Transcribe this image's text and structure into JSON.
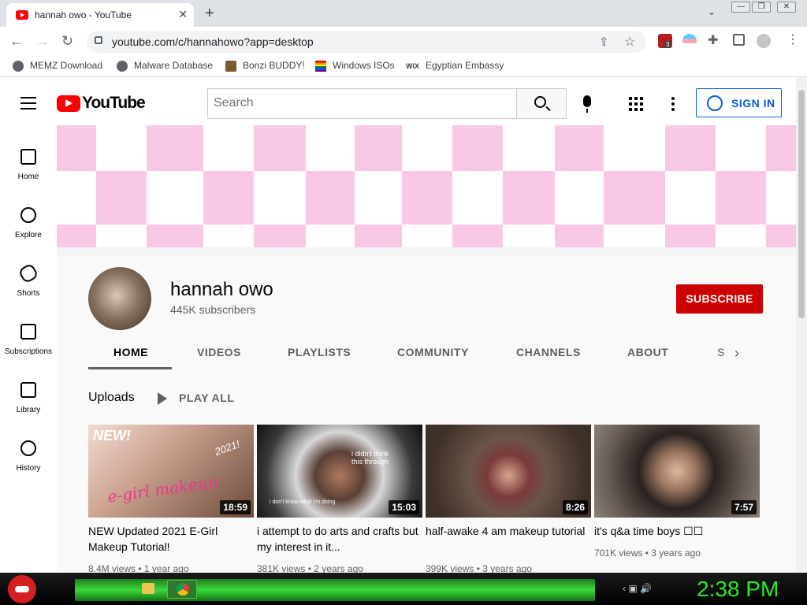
{
  "browser": {
    "tab_title": "hannah owo - YouTube",
    "tab_close": "✕",
    "new_tab": "+",
    "tab_search": "⌄",
    "url": "youtube.com/c/hannahowo?app=desktop",
    "window_controls": [
      "—",
      "❐",
      "✕"
    ],
    "extension_badge": "3",
    "bookmarks": [
      {
        "label": "MEMZ Download",
        "icon": "globe-icon"
      },
      {
        "label": "Malware Database",
        "icon": "globe-icon"
      },
      {
        "label": "Bonzi BUDDY!",
        "icon": "bonzi-icon"
      },
      {
        "label": "Windows ISOs",
        "icon": "windows-icon"
      },
      {
        "label": "Egyptian Embassy",
        "icon": "wix-icon"
      }
    ],
    "wix_text": "WIX"
  },
  "youtube": {
    "logo_text": "YouTube",
    "search_placeholder": "Search",
    "sign_in": "SIGN IN",
    "guide": [
      {
        "label": "Home",
        "icon": "home-icon"
      },
      {
        "label": "Explore",
        "icon": "compass-icon"
      },
      {
        "label": "Shorts",
        "icon": "shorts-icon"
      },
      {
        "label": "Subscriptions",
        "icon": "subscriptions-icon"
      },
      {
        "label": "Library",
        "icon": "library-icon"
      },
      {
        "label": "History",
        "icon": "history-icon"
      }
    ],
    "banner_colors": {
      "pink": "#f8c8e6",
      "white": "#ffffff"
    }
  },
  "channel": {
    "name": "hannah owo",
    "subscribers": "445K subscribers",
    "subscribe_label": "SUBSCRIBE",
    "subscribe_color": "#cc0000",
    "tabs": [
      "HOME",
      "VIDEOS",
      "PLAYLISTS",
      "COMMUNITY",
      "CHANNELS",
      "ABOUT"
    ],
    "active_tab": "HOME",
    "tab_partial": "S",
    "tab_next": "›"
  },
  "uploads": {
    "heading": "Uploads",
    "play_all": "PLAY ALL",
    "videos": [
      {
        "title": "NEW Updated 2021 E-Girl Makeup Tutorial!",
        "duration": "18:59",
        "views": "8.4M views",
        "age": "1 year ago"
      },
      {
        "title": "i attempt to do arts and crafts but my interest in it...",
        "duration": "15:03",
        "views": "381K views",
        "age": "2 years ago"
      },
      {
        "title": "half-awake 4 am makeup tutorial",
        "duration": "8:26",
        "views": "399K views",
        "age": "3 years ago"
      },
      {
        "title": "it's q&a time boys ☐☐",
        "duration": "7:57",
        "views": "701K views",
        "age": "3 years ago"
      }
    ],
    "meta_separator": " • "
  },
  "thumbnail_text": {
    "v1_new": "NEW!",
    "v1_year": "2021!",
    "v1_egirl": "e-girl makeup",
    "v2_top": "i didn't think this through",
    "v2_bottom": "i don't know what i'm doing"
  },
  "taskbar": {
    "clock": "2:38 PM",
    "tray": "‹  ▣  🔊"
  }
}
